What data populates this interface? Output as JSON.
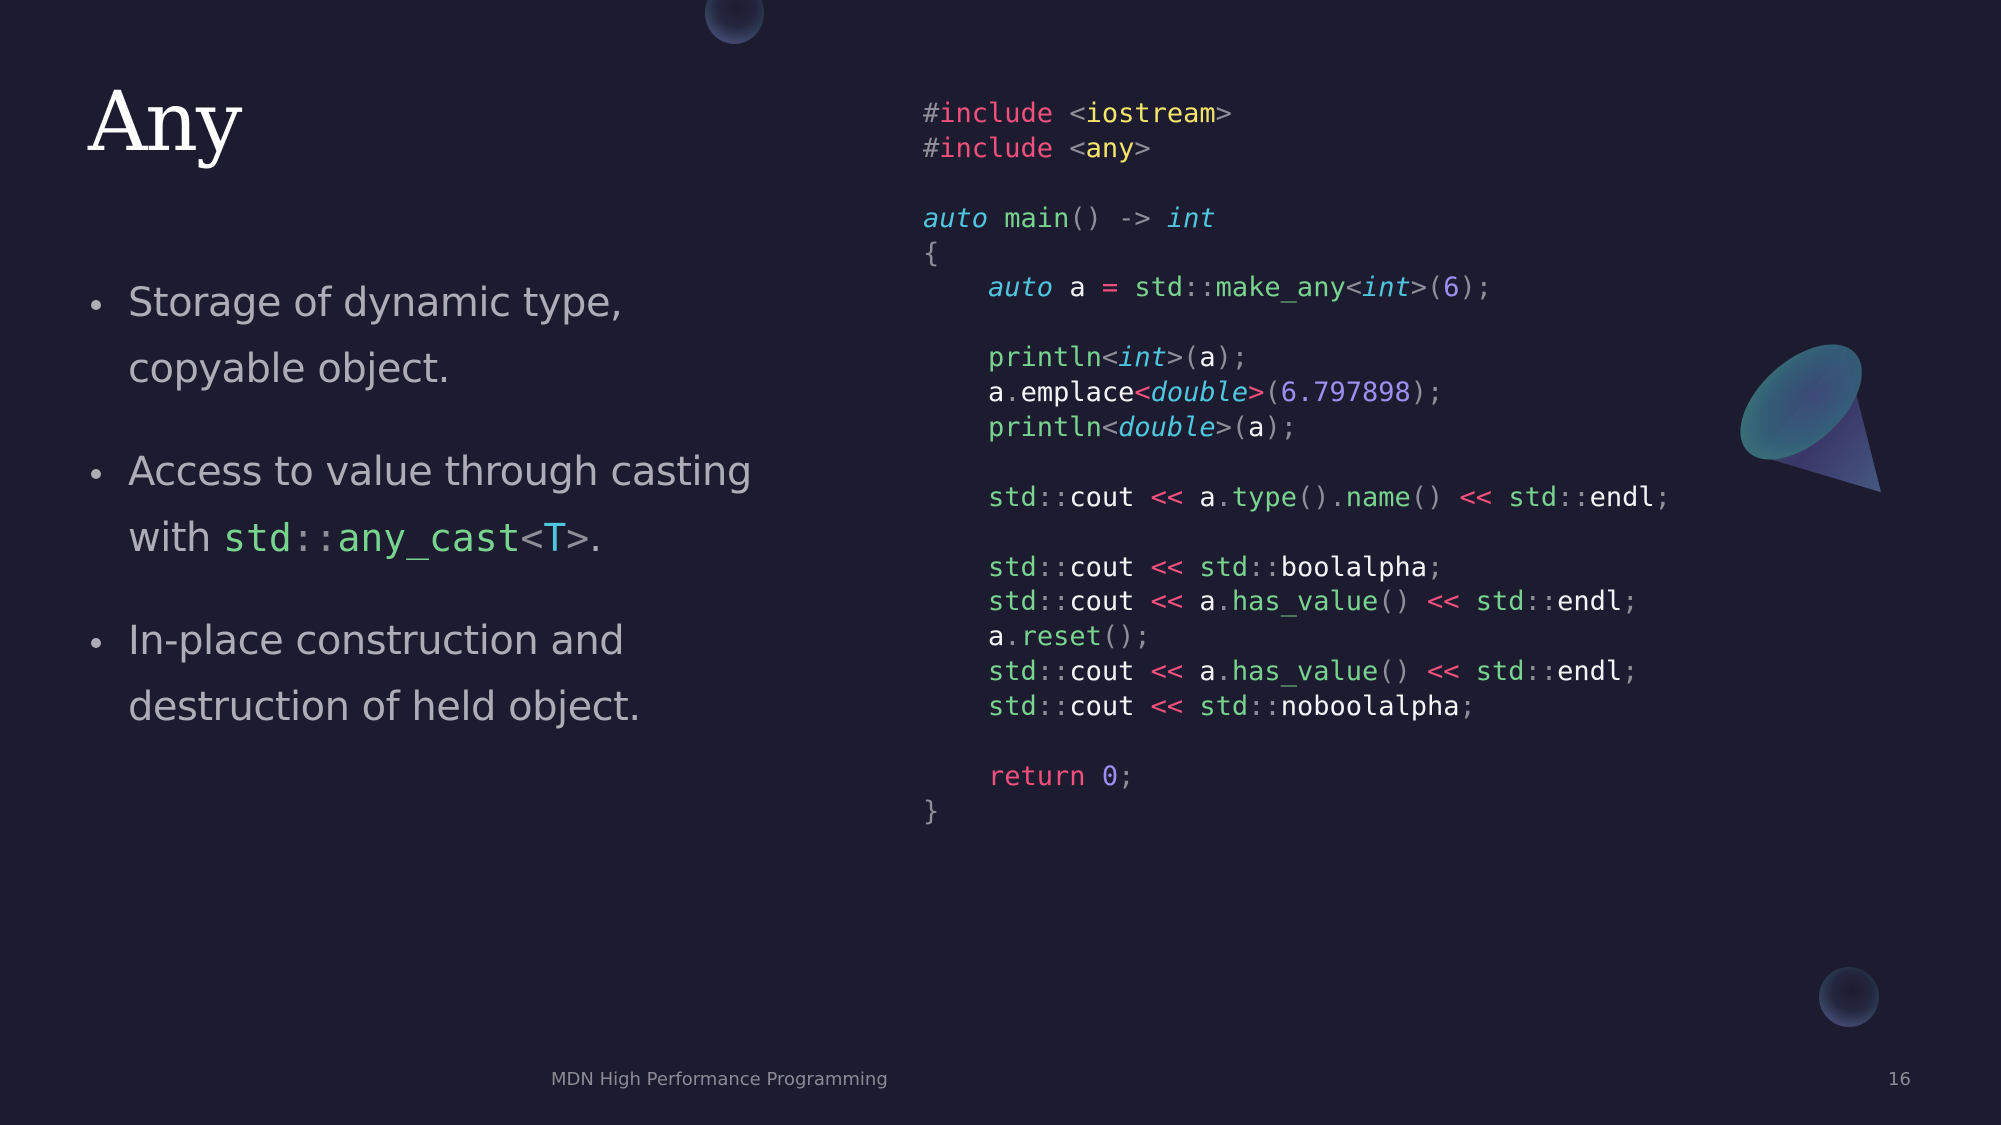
{
  "slide": {
    "title": "Any",
    "bullets": [
      {
        "text": "Storage of dynamic type, copyable object."
      },
      {
        "text_before": "Access to value through casting with ",
        "code": {
          "ns": "std",
          "sep": "::",
          "fn": "any_cast",
          "lt": "<",
          "tparam": "T",
          "gt": ">"
        },
        "text_after": "."
      },
      {
        "text": "In-place construction and destruction of held object."
      }
    ]
  },
  "code_block": {
    "language": "cpp",
    "lines": [
      [
        [
          "#",
          "gray"
        ],
        [
          "include",
          "pink"
        ],
        [
          " ",
          ""
        ],
        [
          "<",
          "gray"
        ],
        [
          "iostream",
          "yellow"
        ],
        [
          ">",
          "gray"
        ]
      ],
      [
        [
          "#",
          "gray"
        ],
        [
          "include",
          "pink"
        ],
        [
          " ",
          ""
        ],
        [
          "<",
          "gray"
        ],
        [
          "any",
          "yellow"
        ],
        [
          ">",
          "gray"
        ]
      ],
      [],
      [
        [
          "auto",
          "cyan-i"
        ],
        [
          " ",
          ""
        ],
        [
          "main",
          "green"
        ],
        [
          "()",
          "gray"
        ],
        [
          " -> ",
          "gray"
        ],
        [
          "int",
          "cyan-i"
        ]
      ],
      [
        [
          "{",
          "gray"
        ]
      ],
      [
        [
          "    ",
          ""
        ],
        [
          "auto",
          "cyan-i"
        ],
        [
          " a ",
          "white"
        ],
        [
          "=",
          "pink"
        ],
        [
          " std",
          "green"
        ],
        [
          "::",
          "gray"
        ],
        [
          "make_any",
          "green"
        ],
        [
          "<",
          "gray"
        ],
        [
          "int",
          "cyan-i"
        ],
        [
          ">",
          "gray"
        ],
        [
          "(",
          "gray"
        ],
        [
          "6",
          "purple"
        ],
        [
          ");",
          "gray"
        ]
      ],
      [],
      [
        [
          "    ",
          ""
        ],
        [
          "println",
          "green"
        ],
        [
          "<",
          "gray"
        ],
        [
          "int",
          "cyan-i"
        ],
        [
          ">",
          "gray"
        ],
        [
          "(",
          "gray"
        ],
        [
          "a",
          "white"
        ],
        [
          ");",
          "gray"
        ]
      ],
      [
        [
          "    ",
          ""
        ],
        [
          "a",
          "white"
        ],
        [
          ".",
          "gray"
        ],
        [
          "emplace",
          "white"
        ],
        [
          "<",
          "pink"
        ],
        [
          "double",
          "cyan-i"
        ],
        [
          ">",
          "pink"
        ],
        [
          "(",
          "gray"
        ],
        [
          "6.797898",
          "purple"
        ],
        [
          ");",
          "gray"
        ]
      ],
      [
        [
          "    ",
          ""
        ],
        [
          "println",
          "green"
        ],
        [
          "<",
          "gray"
        ],
        [
          "double",
          "cyan-i"
        ],
        [
          ">",
          "gray"
        ],
        [
          "(",
          "gray"
        ],
        [
          "a",
          "white"
        ],
        [
          ");",
          "gray"
        ]
      ],
      [],
      [
        [
          "    ",
          ""
        ],
        [
          "std",
          "green"
        ],
        [
          "::",
          "gray"
        ],
        [
          "cout",
          "white"
        ],
        [
          " ",
          ""
        ],
        [
          "<<",
          "pink"
        ],
        [
          " a",
          "white"
        ],
        [
          ".",
          "gray"
        ],
        [
          "type",
          "green"
        ],
        [
          "()",
          "gray"
        ],
        [
          ".",
          "gray"
        ],
        [
          "name",
          "green"
        ],
        [
          "()",
          "gray"
        ],
        [
          " ",
          ""
        ],
        [
          "<<",
          "pink"
        ],
        [
          " std",
          "green"
        ],
        [
          "::",
          "gray"
        ],
        [
          "endl",
          "white"
        ],
        [
          ";",
          "gray"
        ]
      ],
      [],
      [
        [
          "    ",
          ""
        ],
        [
          "std",
          "green"
        ],
        [
          "::",
          "gray"
        ],
        [
          "cout",
          "white"
        ],
        [
          " ",
          ""
        ],
        [
          "<<",
          "pink"
        ],
        [
          " std",
          "green"
        ],
        [
          "::",
          "gray"
        ],
        [
          "boolalpha",
          "white"
        ],
        [
          ";",
          "gray"
        ]
      ],
      [
        [
          "    ",
          ""
        ],
        [
          "std",
          "green"
        ],
        [
          "::",
          "gray"
        ],
        [
          "cout",
          "white"
        ],
        [
          " ",
          ""
        ],
        [
          "<<",
          "pink"
        ],
        [
          " a",
          "white"
        ],
        [
          ".",
          "gray"
        ],
        [
          "has_value",
          "green"
        ],
        [
          "()",
          "gray"
        ],
        [
          " ",
          ""
        ],
        [
          "<<",
          "pink"
        ],
        [
          " std",
          "green"
        ],
        [
          "::",
          "gray"
        ],
        [
          "endl",
          "white"
        ],
        [
          ";",
          "gray"
        ]
      ],
      [
        [
          "    ",
          ""
        ],
        [
          "a",
          "white"
        ],
        [
          ".",
          "gray"
        ],
        [
          "reset",
          "green"
        ],
        [
          "();",
          "gray"
        ]
      ],
      [
        [
          "    ",
          ""
        ],
        [
          "std",
          "green"
        ],
        [
          "::",
          "gray"
        ],
        [
          "cout",
          "white"
        ],
        [
          " ",
          ""
        ],
        [
          "<<",
          "pink"
        ],
        [
          " a",
          "white"
        ],
        [
          ".",
          "gray"
        ],
        [
          "has_value",
          "green"
        ],
        [
          "()",
          "gray"
        ],
        [
          " ",
          ""
        ],
        [
          "<<",
          "pink"
        ],
        [
          " std",
          "green"
        ],
        [
          "::",
          "gray"
        ],
        [
          "endl",
          "white"
        ],
        [
          ";",
          "gray"
        ]
      ],
      [
        [
          "    ",
          ""
        ],
        [
          "std",
          "green"
        ],
        [
          "::",
          "gray"
        ],
        [
          "cout",
          "white"
        ],
        [
          " ",
          ""
        ],
        [
          "<<",
          "pink"
        ],
        [
          " std",
          "green"
        ],
        [
          "::",
          "gray"
        ],
        [
          "noboolalpha",
          "white"
        ],
        [
          ";",
          "gray"
        ]
      ],
      [],
      [
        [
          "    ",
          ""
        ],
        [
          "return",
          "pink"
        ],
        [
          " ",
          ""
        ],
        [
          "0",
          "purple"
        ],
        [
          ";",
          "gray"
        ]
      ],
      [
        [
          "}",
          "gray"
        ]
      ]
    ]
  },
  "footer": {
    "text": "MDN High Performance Programming",
    "page_number": "16"
  },
  "decorations": [
    "sphere-top",
    "cone",
    "sphere-bottom"
  ],
  "colors": {
    "background": "#1d1b2f",
    "title": "#ffffff",
    "body_text": "#aeacb8",
    "code_green": "#78d38e",
    "code_cyan": "#4fc6de",
    "code_pink": "#f2507c",
    "code_yellow": "#f4e46a",
    "code_purple": "#9d8ef0",
    "code_gray": "#8f8d99",
    "code_white": "#f4f4f6"
  }
}
